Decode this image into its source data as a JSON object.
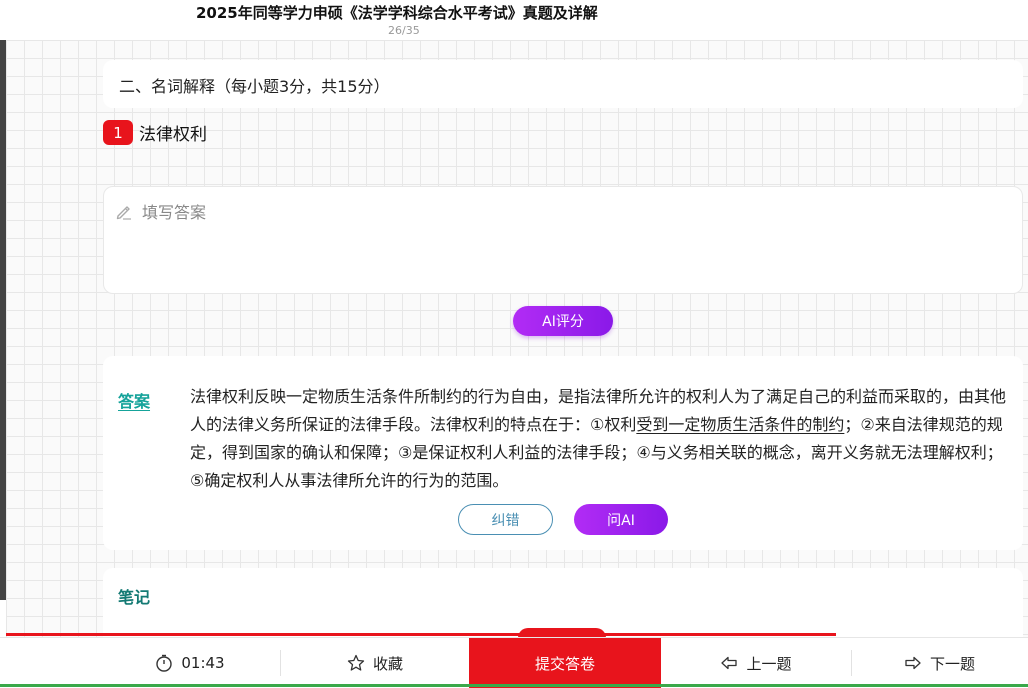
{
  "header": {
    "title": "2025年同等学力申硕《法学学科综合水平考试》真题及详解",
    "page_count": "26/35"
  },
  "section": {
    "title": "二、名词解释（每小题3分，共15分）"
  },
  "question": {
    "number": "1",
    "text": "法律权利"
  },
  "answer_input": {
    "placeholder": "填写答案"
  },
  "ai_score_button": "AI评分",
  "answer": {
    "label": "答案",
    "text_parts": [
      "法律权利反映一定物质生活条件所制约的行为自由，是指法律所允许的权利人为了满足自己的利益而采取的，由其他人的法律义务所保证的法律手段。法律权利的特点在于：①权利",
      "受到一定物质生活条件的制约",
      "；②来自法律规范的规定，得到国家的确认和保障；③是保证权利人利益的法律手段；④与义务相关联的概念，离开义务就无法理解权利；⑤确定权利人从事法律所允许的行为的范围。"
    ],
    "report_button": "纠错",
    "ask_ai_button": "问AI"
  },
  "notes": {
    "label": "笔记"
  },
  "bottom_bar": {
    "timer": "01:43",
    "favorite": "收藏",
    "submit": "提交答卷",
    "prev": "上一题",
    "next": "下一题"
  },
  "colors": {
    "accent_red": "#e8141c",
    "ai_purple": "#a020f0",
    "answer_teal": "#15a39a"
  },
  "icons": {
    "pencil": "pencil-icon",
    "timer": "stopwatch-icon",
    "favorite": "star-icon",
    "prev": "arrow-left-icon",
    "next": "arrow-right-icon"
  }
}
